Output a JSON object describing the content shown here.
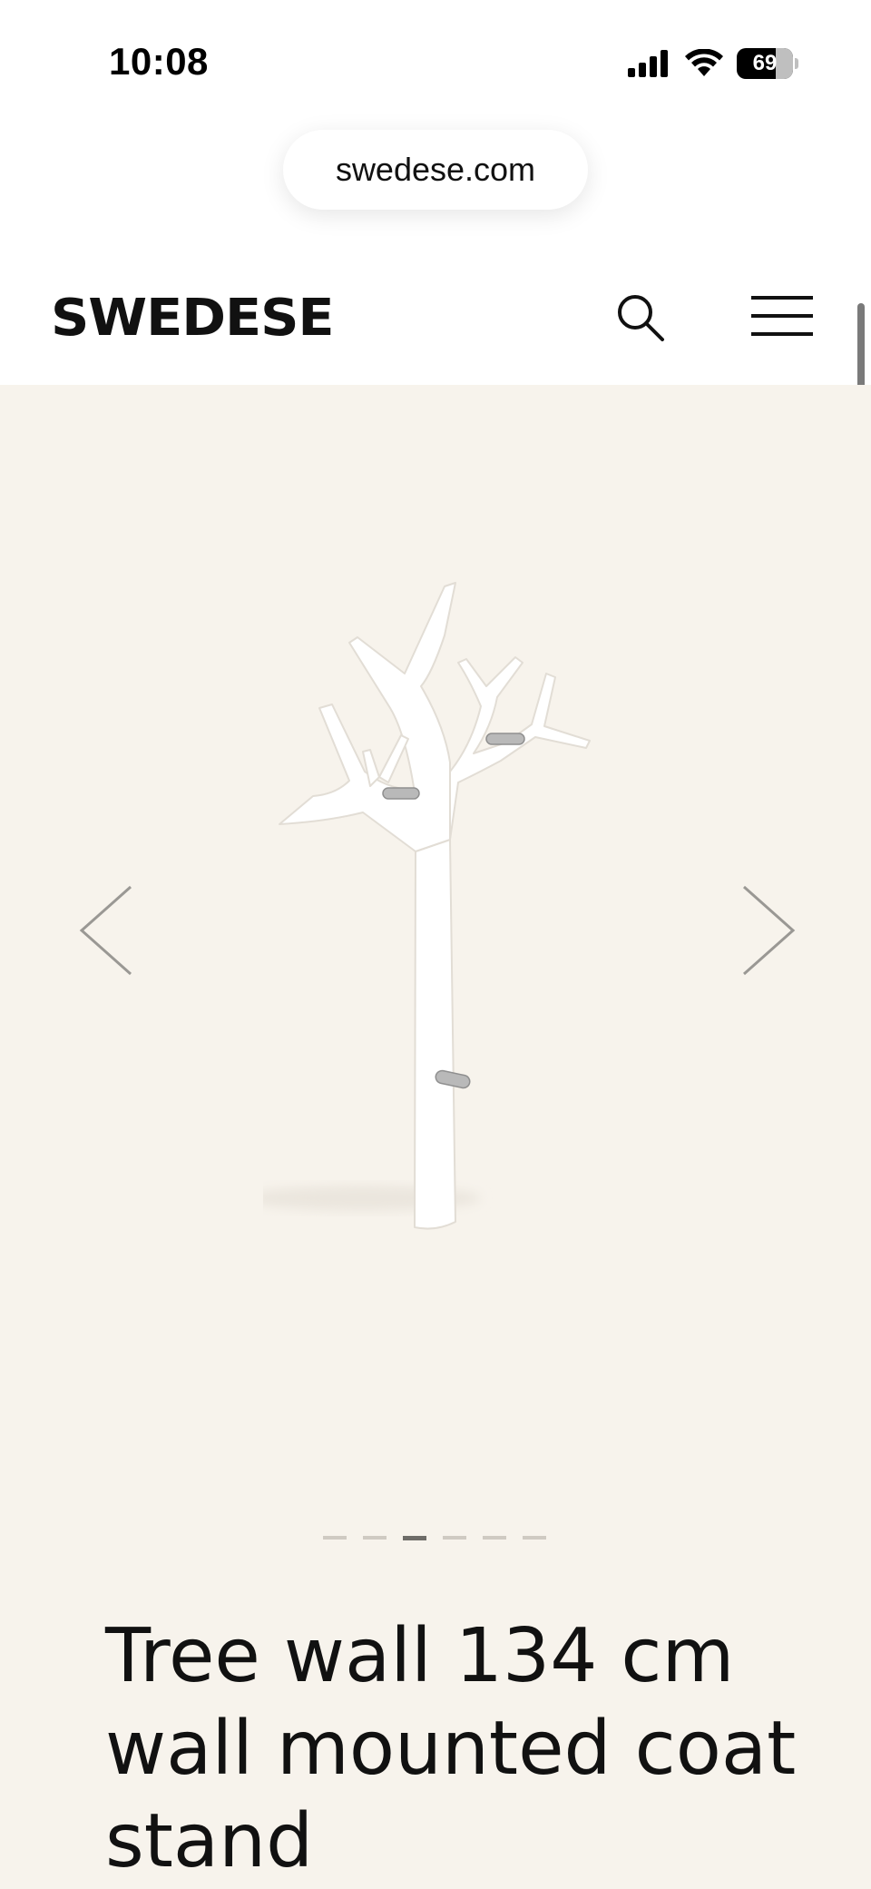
{
  "status_bar": {
    "time": "10:08",
    "battery": "69",
    "icons": [
      "signal-icon",
      "wifi-icon",
      "battery-icon"
    ]
  },
  "browser": {
    "url": "swedese.com"
  },
  "header": {
    "logo": "SWEDESE",
    "icons": [
      "search-icon",
      "menu-icon"
    ]
  },
  "gallery": {
    "image_count": 6,
    "active_index": 2,
    "icons": [
      "arrow-left-icon",
      "arrow-right-icon"
    ]
  },
  "product": {
    "title": "Tree wall 134 cm wall mounted coat stand"
  },
  "colors": {
    "gallery_bg": "#f7f3ec",
    "text": "#111111",
    "dot_inactive": "#cfcac2",
    "dot_active": "#6e6c68"
  }
}
